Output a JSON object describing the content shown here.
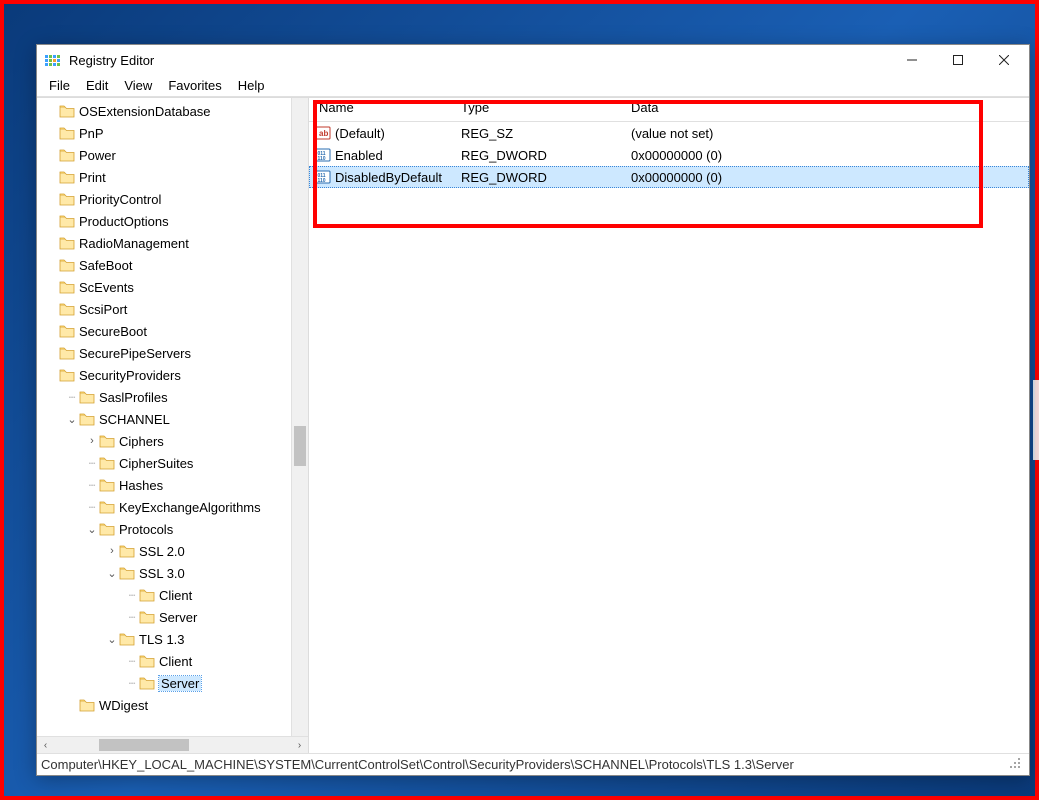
{
  "window": {
    "title": "Registry Editor"
  },
  "menu": {
    "file": "File",
    "edit": "Edit",
    "view": "View",
    "favorites": "Favorites",
    "help": "Help"
  },
  "tree": [
    {
      "indent": 0,
      "expander": "",
      "label": "OSExtensionDatabase"
    },
    {
      "indent": 0,
      "expander": "",
      "label": "PnP"
    },
    {
      "indent": 0,
      "expander": "",
      "label": "Power"
    },
    {
      "indent": 0,
      "expander": "",
      "label": "Print"
    },
    {
      "indent": 0,
      "expander": "",
      "label": "PriorityControl"
    },
    {
      "indent": 0,
      "expander": "",
      "label": "ProductOptions"
    },
    {
      "indent": 0,
      "expander": "",
      "label": "RadioManagement"
    },
    {
      "indent": 0,
      "expander": "",
      "label": "SafeBoot"
    },
    {
      "indent": 0,
      "expander": "",
      "label": "ScEvents"
    },
    {
      "indent": 0,
      "expander": "",
      "label": "ScsiPort"
    },
    {
      "indent": 0,
      "expander": "",
      "label": "SecureBoot"
    },
    {
      "indent": 0,
      "expander": "",
      "label": "SecurePipeServers"
    },
    {
      "indent": 0,
      "expander": "",
      "label": "SecurityProviders"
    },
    {
      "indent": 1,
      "expander": "",
      "label": "SaslProfiles",
      "dotted": true
    },
    {
      "indent": 1,
      "expander": "v",
      "label": "SCHANNEL"
    },
    {
      "indent": 2,
      "expander": ">",
      "label": "Ciphers",
      "dotted": true
    },
    {
      "indent": 2,
      "expander": "",
      "label": "CipherSuites",
      "dotted": true
    },
    {
      "indent": 2,
      "expander": "",
      "label": "Hashes",
      "dotted": true
    },
    {
      "indent": 2,
      "expander": "",
      "label": "KeyExchangeAlgorithms",
      "dotted": true
    },
    {
      "indent": 2,
      "expander": "v",
      "label": "Protocols"
    },
    {
      "indent": 3,
      "expander": ">",
      "label": "SSL 2.0",
      "dotted": true
    },
    {
      "indent": 3,
      "expander": "v",
      "label": "SSL 3.0",
      "dotted": true
    },
    {
      "indent": 4,
      "expander": "",
      "label": "Client",
      "dotted": true
    },
    {
      "indent": 4,
      "expander": "",
      "label": "Server",
      "dotted": true
    },
    {
      "indent": 3,
      "expander": "v",
      "label": "TLS 1.3"
    },
    {
      "indent": 4,
      "expander": "",
      "label": "Client",
      "dotted": true
    },
    {
      "indent": 4,
      "expander": "",
      "label": "Server",
      "selected": true,
      "dotted": true
    },
    {
      "indent": 1,
      "expander": "",
      "label": "WDigest"
    }
  ],
  "list": {
    "headers": {
      "name": "Name",
      "type": "Type",
      "data": "Data"
    },
    "rows": [
      {
        "icon": "sz",
        "name": "(Default)",
        "type": "REG_SZ",
        "data": "(value not set)"
      },
      {
        "icon": "dw",
        "name": "Enabled",
        "type": "REG_DWORD",
        "data": "0x00000000 (0)"
      },
      {
        "icon": "dw",
        "name": "DisabledByDefault",
        "type": "REG_DWORD",
        "data": "0x00000000 (0)",
        "selected": true
      }
    ]
  },
  "status": {
    "path": "Computer\\HKEY_LOCAL_MACHINE\\SYSTEM\\CurrentControlSet\\Control\\SecurityProviders\\SCHANNEL\\Protocols\\TLS 1.3\\Server"
  }
}
